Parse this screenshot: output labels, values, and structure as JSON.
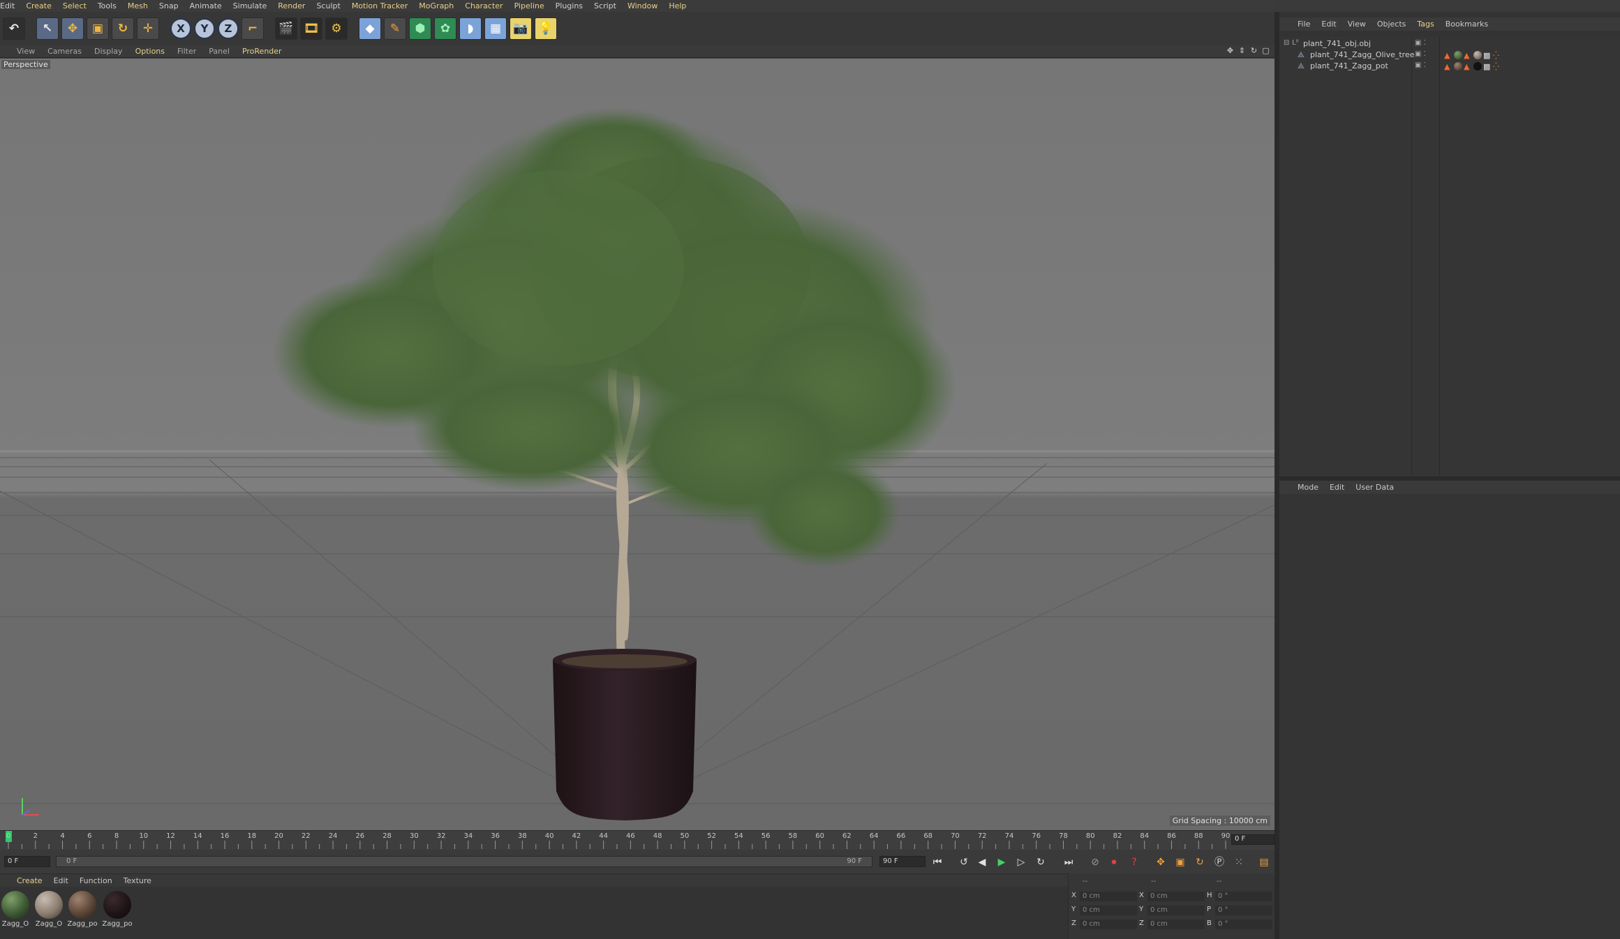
{
  "menu": [
    "Edit",
    "Create",
    "Select",
    "Tools",
    "Mesh",
    "Snap",
    "Animate",
    "Simulate",
    "Render",
    "Sculpt",
    "Motion Tracker",
    "MoGraph",
    "Character",
    "Pipeline",
    "Plugins",
    "Script",
    "Window",
    "Help"
  ],
  "toolbar": {
    "axis_x": "X",
    "axis_y": "Y",
    "axis_z": "Z"
  },
  "viewport": {
    "menu": [
      "View",
      "Cameras",
      "Display",
      "Options",
      "Filter",
      "Panel",
      "ProRender"
    ],
    "label": "Perspective",
    "grid_spacing": "Grid Spacing : 10000 cm"
  },
  "timeline": {
    "ticks": [
      "0",
      "2",
      "4",
      "6",
      "8",
      "10",
      "12",
      "14",
      "16",
      "18",
      "20",
      "22",
      "24",
      "26",
      "28",
      "30",
      "32",
      "34",
      "36",
      "38",
      "40",
      "42",
      "44",
      "46",
      "48",
      "50",
      "52",
      "54",
      "56",
      "58",
      "60",
      "62",
      "64",
      "66",
      "68",
      "70",
      "72",
      "74",
      "76",
      "78",
      "80",
      "82",
      "84",
      "86",
      "88",
      "90"
    ],
    "current_frame": "0 F",
    "start_frame": "0 F",
    "slider_start": "0 F",
    "slider_end": "90 F",
    "end_frame": "90 F"
  },
  "materials": {
    "menu": [
      "Create",
      "Edit",
      "Function",
      "Texture"
    ],
    "items": [
      {
        "label": "Zagg_O",
        "color": "#3d5a33"
      },
      {
        "label": "Zagg_O",
        "color": "#8b7d70"
      },
      {
        "label": "Zagg_po",
        "color": "#5b4536"
      },
      {
        "label": "Zagg_po",
        "color": "#1e1416"
      }
    ]
  },
  "coords": {
    "header": [
      "--",
      "--",
      "--"
    ],
    "rows": [
      {
        "a": "X",
        "av": "0 cm",
        "b": "X",
        "bv": "0 cm",
        "c": "H",
        "cv": "0 °"
      },
      {
        "a": "Y",
        "av": "0 cm",
        "b": "Y",
        "bv": "0 cm",
        "c": "P",
        "cv": "0 °"
      },
      {
        "a": "Z",
        "av": "0 cm",
        "b": "Z",
        "bv": "0 cm",
        "c": "B",
        "cv": "0 °"
      }
    ]
  },
  "object_manager": {
    "menu": [
      "File",
      "Edit",
      "View",
      "Objects",
      "Tags",
      "Bookmarks"
    ],
    "objects": [
      {
        "name": "plant_741_obj.obj",
        "level": 0
      },
      {
        "name": "plant_741_Zagg_Olive_tree",
        "level": 1
      },
      {
        "name": "plant_741_Zagg_pot",
        "level": 1
      }
    ]
  },
  "attribute_manager": {
    "menu": [
      "Mode",
      "Edit",
      "User Data"
    ]
  },
  "colors": {
    "accent": "#e8d08a",
    "playhead": "#2fc86a",
    "foliage": "#4d6b3e",
    "pot": "#2a1a1d"
  }
}
